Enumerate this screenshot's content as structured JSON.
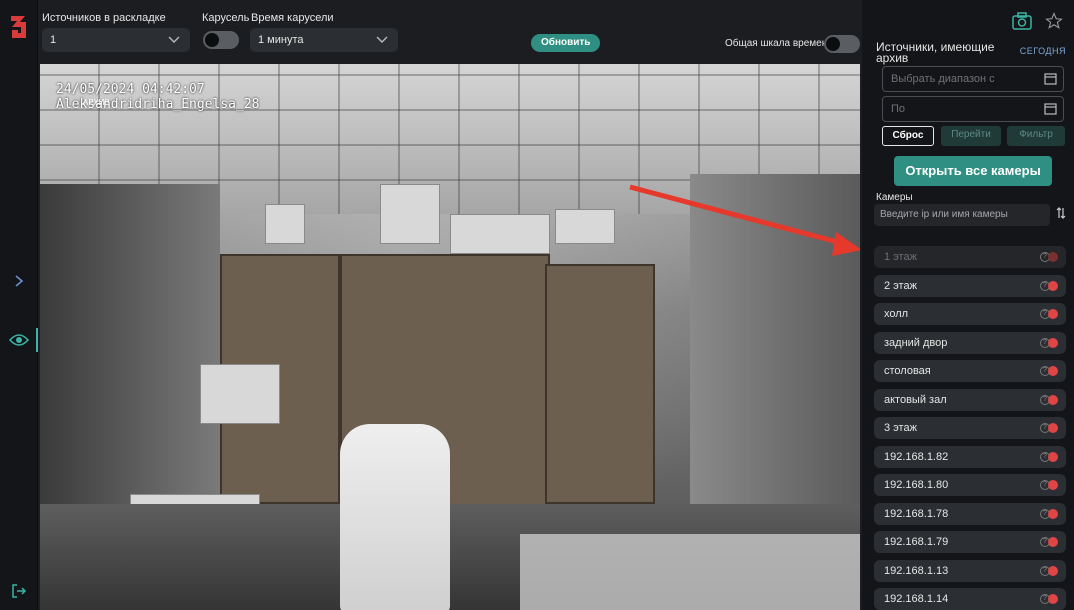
{
  "top": {
    "layout_label": "Источников в раскладке",
    "layout_value": "1",
    "carousel_label": "Карусель",
    "carousel_time_label": "Время карусели",
    "carousel_time_value": "1 минута",
    "refresh_label": "Обновить",
    "timeline_label": "Общая шкала времени"
  },
  "camera": {
    "osd_datetime": "24/05/2024 04:42:07",
    "osd_name": "Aleksandridriha_Engelsa_28",
    "archive_badge": "АРХИВ"
  },
  "panel": {
    "title": "Источники, имеющие архив",
    "today_label": "СЕГОДНЯ",
    "from_placeholder": "Выбрать диапазон с",
    "to_placeholder": "По",
    "reset_label": "Сброс",
    "goto_label": "Перейти",
    "filter_label": "Фильтр",
    "open_all_label": "Открыть все камеры",
    "cameras_label": "Камеры",
    "search_placeholder": "Введите ip или имя камеры",
    "cameras": [
      {
        "name": "1 этаж",
        "dim": true
      },
      {
        "name": "2 этаж"
      },
      {
        "name": "холл"
      },
      {
        "name": "задний двор"
      },
      {
        "name": "столовая"
      },
      {
        "name": "актовый зал"
      },
      {
        "name": "3 этаж"
      },
      {
        "name": "192.168.1.82"
      },
      {
        "name": "192.168.1.80"
      },
      {
        "name": "192.168.1.78"
      },
      {
        "name": "192.168.1.79"
      },
      {
        "name": "192.168.1.13"
      },
      {
        "name": "192.168.1.14"
      }
    ]
  },
  "colors": {
    "accent": "#2f8f82",
    "status_offline": "#e04545",
    "arrow": "#e6392b"
  }
}
